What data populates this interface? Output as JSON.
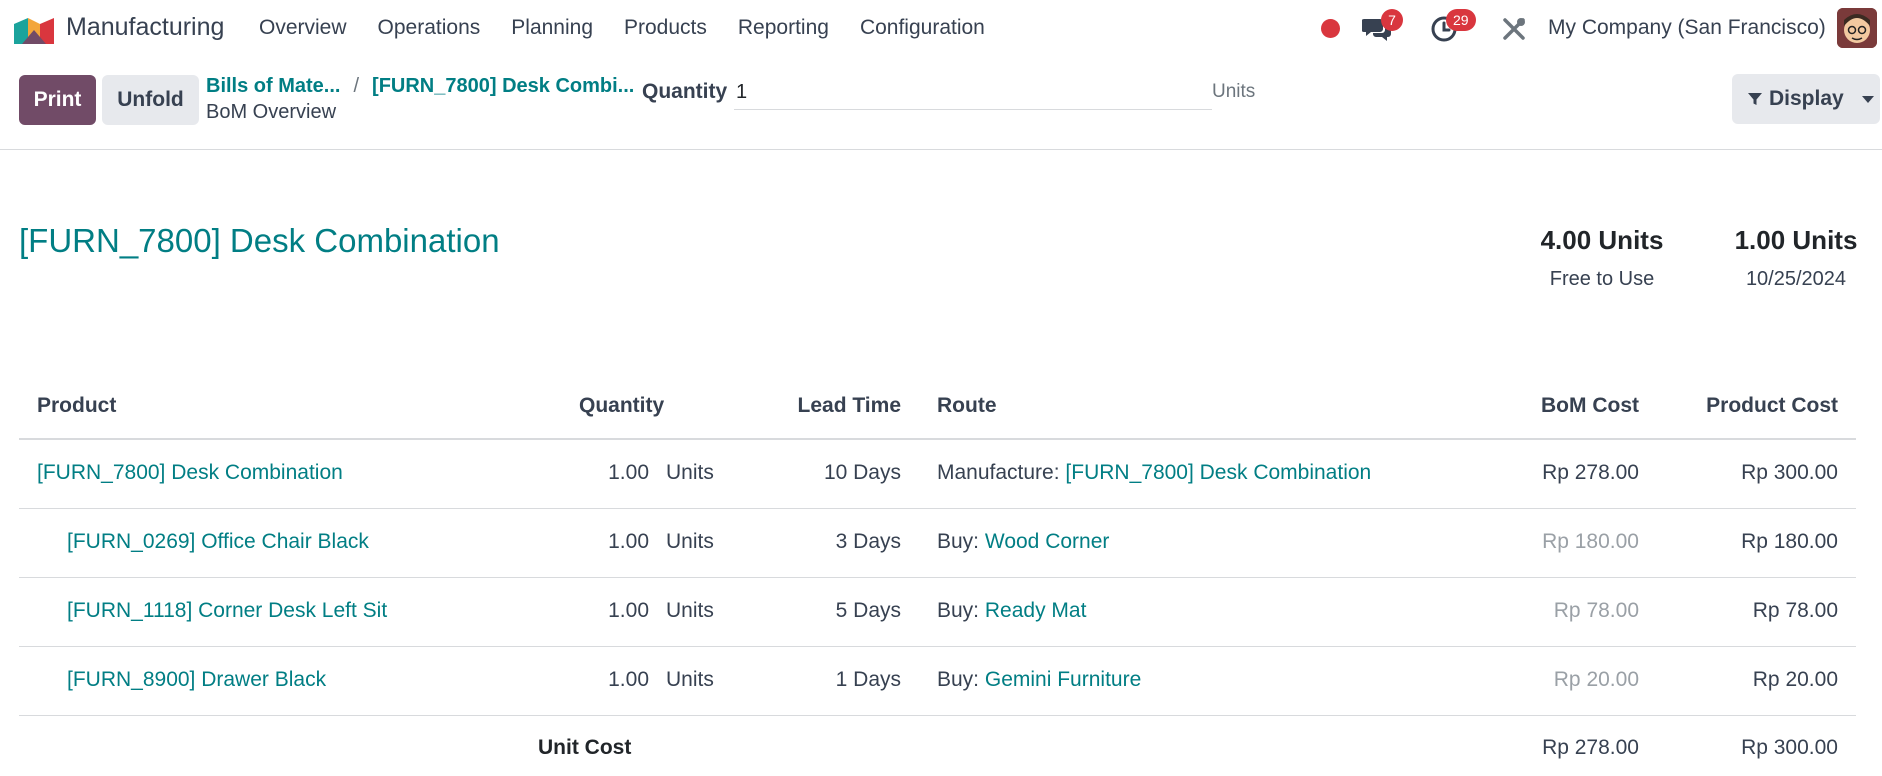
{
  "app": {
    "name": "Manufacturing"
  },
  "nav": {
    "menu": [
      "Overview",
      "Operations",
      "Planning",
      "Products",
      "Reporting",
      "Configuration"
    ],
    "chat_count": "7",
    "activity_count": "29",
    "company": "My Company (San Francisco)"
  },
  "control": {
    "print_label": "Print",
    "unfold_label": "Unfold",
    "breadcrumb": [
      "Bills of Mate...",
      "[FURN_7800] Desk Combi..."
    ],
    "breadcrumb_separator": "/",
    "current": "BoM Overview",
    "quantity_label": "Quantity",
    "quantity_value": "1",
    "quantity_unit": "Units",
    "display_label": "Display"
  },
  "report": {
    "title": "[FURN_7800] Desk Combination",
    "stats": [
      {
        "value": "4.00 Units",
        "label": "Free to Use"
      },
      {
        "value": "1.00 Units",
        "label": "10/25/2024"
      }
    ],
    "columns": {
      "product": "Product",
      "quantity": "Quantity",
      "lead_time": "Lead Time",
      "route": "Route",
      "bom_cost": "BoM Cost",
      "product_cost": "Product Cost"
    },
    "rows": [
      {
        "product": "[FURN_7800] Desk Combination",
        "quantity": "1.00",
        "uom": "Units",
        "lead_time": "10 Days",
        "route_prefix": "Manufacture:",
        "route_link": "[FURN_7800] Desk Combination",
        "bom_cost": "Rp 278.00",
        "product_cost": "Rp 300.00"
      },
      {
        "product": "[FURN_0269] Office Chair Black",
        "quantity": "1.00",
        "uom": "Units",
        "lead_time": "3 Days",
        "route_prefix": "Buy:",
        "route_link": "Wood Corner",
        "bom_cost": "Rp 180.00",
        "product_cost": "Rp 180.00"
      },
      {
        "product": "[FURN_1118] Corner Desk Left Sit",
        "quantity": "1.00",
        "uom": "Units",
        "lead_time": "5 Days",
        "route_prefix": "Buy:",
        "route_link": "Ready Mat",
        "bom_cost": "Rp 78.00",
        "product_cost": "Rp 78.00"
      },
      {
        "product": "[FURN_8900] Drawer Black",
        "quantity": "1.00",
        "uom": "Units",
        "lead_time": "1 Days",
        "route_prefix": "Buy:",
        "route_link": "Gemini Furniture",
        "bom_cost": "Rp 20.00",
        "product_cost": "Rp 20.00"
      }
    ],
    "footer": {
      "label": "Unit Cost",
      "bom_cost": "Rp 278.00",
      "product_cost": "Rp 300.00"
    }
  },
  "colors": {
    "primary": "#714b67",
    "link": "#017e84",
    "badge": "#d9363e"
  }
}
